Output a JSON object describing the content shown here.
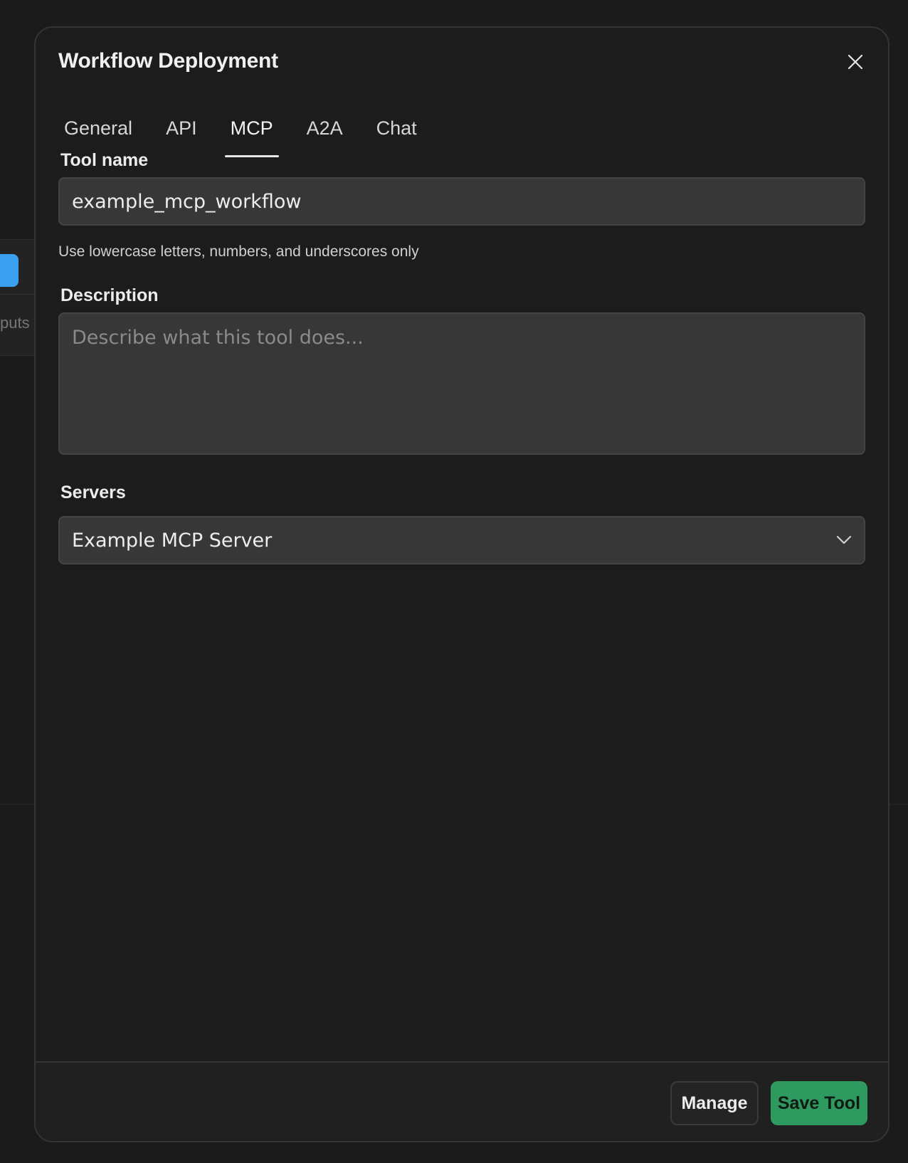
{
  "background": {
    "node_text": "puts"
  },
  "modal": {
    "title": "Workflow Deployment",
    "tabs": [
      {
        "label": "General"
      },
      {
        "label": "API"
      },
      {
        "label": "MCP",
        "active": true
      },
      {
        "label": "A2A"
      },
      {
        "label": "Chat"
      }
    ],
    "tool_name": {
      "label": "Tool name",
      "value": "example_mcp_workflow",
      "hint": "Use lowercase letters, numbers, and underscores only"
    },
    "description": {
      "label": "Description",
      "value": "",
      "placeholder": "Describe what this tool does..."
    },
    "servers": {
      "label": "Servers",
      "selected": "Example MCP Server"
    },
    "footer": {
      "manage_label": "Manage",
      "save_label": "Save Tool"
    }
  },
  "colors": {
    "accent": "#2f9a60",
    "background": "#1b1b1b",
    "input_bg": "#373737"
  },
  "icons": {
    "close": "close-icon",
    "dropdown": "chevron-down-icon"
  }
}
